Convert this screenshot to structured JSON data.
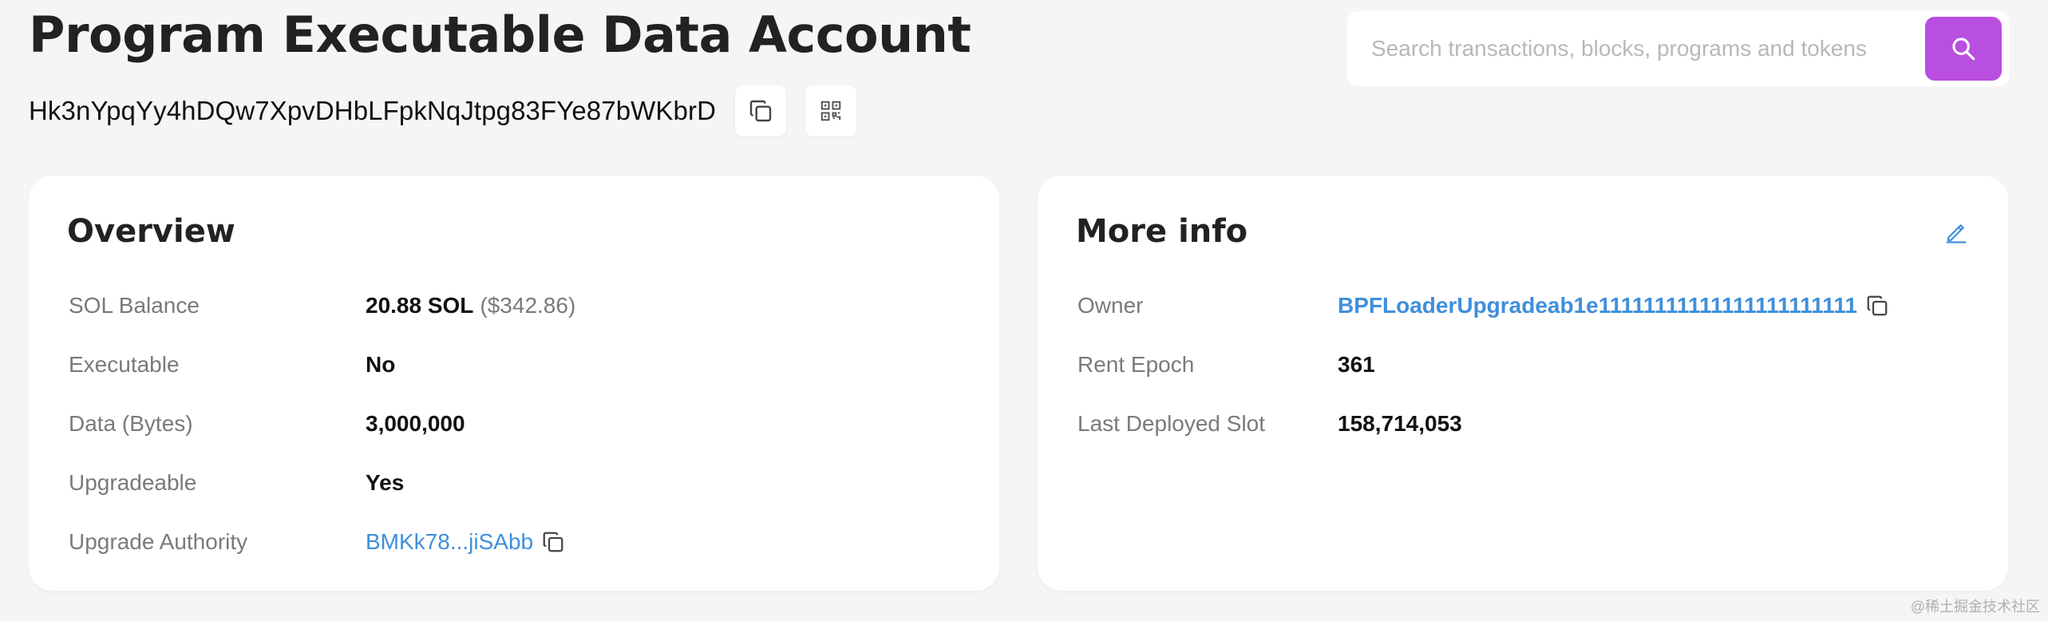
{
  "header": {
    "title": "Program Executable Data Account",
    "address": "Hk3nYpqYy4hDQw7XpvDHbLFpkNqJtpg83FYe87bWKbrD"
  },
  "search": {
    "placeholder": "Search transactions, blocks, programs and tokens"
  },
  "overview": {
    "title": "Overview",
    "rows": [
      {
        "label": "SOL Balance",
        "value": "20.88 SOL",
        "extra": "($342.86)"
      },
      {
        "label": "Executable",
        "value": "No"
      },
      {
        "label": "Data (Bytes)",
        "value": "3,000,000"
      },
      {
        "label": "Upgradeable",
        "value": "Yes"
      },
      {
        "label": "Upgrade Authority",
        "value": "BMKk78...jiSAbb"
      }
    ]
  },
  "more_info": {
    "title": "More info",
    "rows": [
      {
        "label": "Owner",
        "value": "BPFLoaderUpgradeab1e11111111111111111111111"
      },
      {
        "label": "Rent Epoch",
        "value": "361"
      },
      {
        "label": "Last Deployed Slot",
        "value": "158,714,053"
      }
    ]
  },
  "watermark": "@稀土掘金技术社区",
  "colors": {
    "accent": "#b84fdf",
    "link": "#3f8fdc",
    "background": "#f5f5f5"
  },
  "icons": {
    "copy": "copy-icon",
    "qr": "qr-code-icon",
    "search": "search-icon",
    "edit": "pencil-icon"
  }
}
